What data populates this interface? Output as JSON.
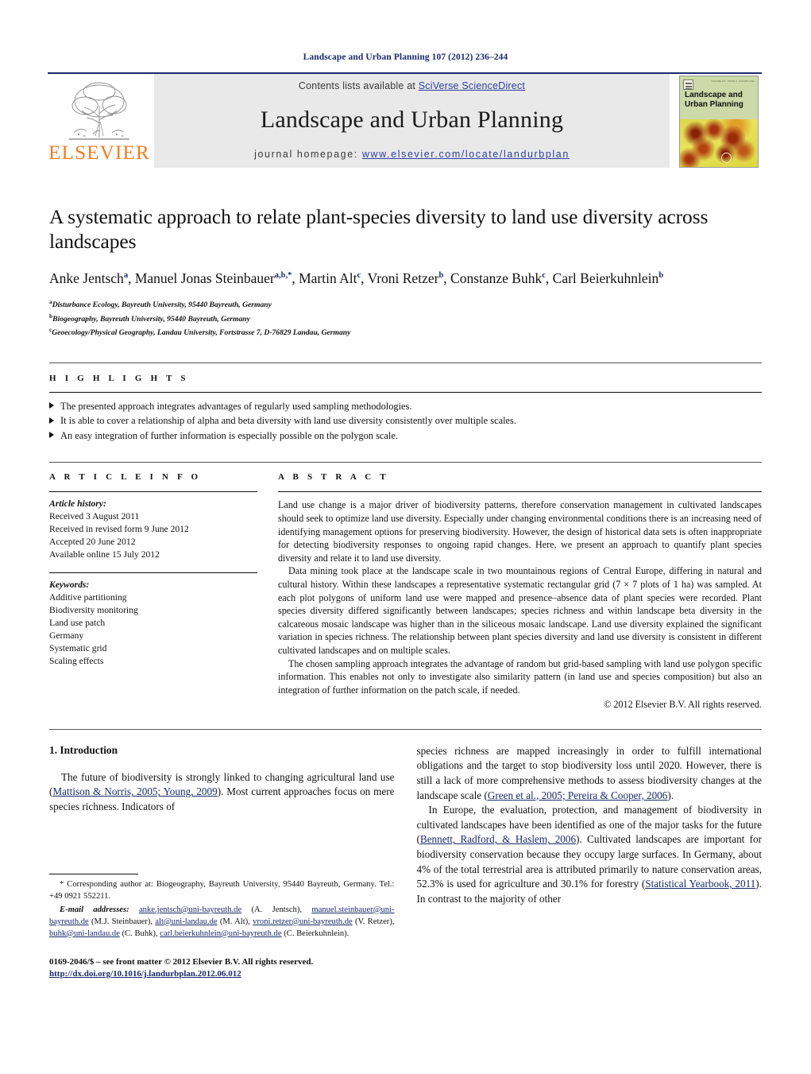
{
  "running_head": "Landscape and Urban Planning 107 (2012) 236–244",
  "masthead": {
    "publisher_wordmark": "ELSEVIER",
    "publisher_logo_icon": "elsevier-tree-icon",
    "contents_prefix": "Contents lists available at ",
    "contents_link": "SciVerse ScienceDirect",
    "journal_title": "Landscape and Urban Planning",
    "homepage_prefix": "journal homepage: ",
    "homepage_url": "www.elsevier.com/locate/landurbplan",
    "cover": {
      "journal_title_line1": "Landscape and",
      "journal_title_line2": "Urban Planning",
      "micro_text": "VOLUME 107 · ISSUE 3 · AUGUST 2012",
      "badge_icon": "elsevier-cover-badge-icon"
    }
  },
  "article": {
    "title": "A systematic approach to relate plant-species diversity to land use diversity across landscapes",
    "authors": [
      {
        "name": "Anke Jentsch",
        "sup": "a",
        "sep": ", "
      },
      {
        "name": "Manuel Jonas Steinbauer",
        "sup": "a,b,*",
        "sep": ", "
      },
      {
        "name": "Martin Alt",
        "sup": "c",
        "sep": ", "
      },
      {
        "name": "Vroni Retzer",
        "sup": "b",
        "sep": ", "
      },
      {
        "name": "Constanze Buhk",
        "sup": "c",
        "sep": ", "
      },
      {
        "name": "Carl Beierkuhnlein",
        "sup": "b",
        "sep": ""
      }
    ],
    "affiliations": [
      {
        "sup": "a",
        "text": "Disturbance Ecology, Bayreuth University, 95440 Bayreuth, Germany"
      },
      {
        "sup": "b",
        "text": "Biogeography, Bayreuth University, 95440 Bayreuth, Germany"
      },
      {
        "sup": "c",
        "text": "Geoecology/Physical Geography, Landau University, Fortstrasse 7, D-76829 Landau, Germany"
      }
    ]
  },
  "highlights": {
    "label": "H I G H L I G H T S",
    "items": [
      "The presented approach integrates advantages of regularly used sampling methodologies.",
      "It is able to cover a relationship of alpha and beta diversity with land use diversity consistently over multiple scales.",
      "An easy integration of further information is especially possible on the polygon scale."
    ]
  },
  "article_info": {
    "label": "A R T I C L E    I N F O",
    "history_head": "Article history:",
    "history": [
      "Received 3 August 2011",
      "Received in revised form 9 June 2012",
      "Accepted 20 June 2012",
      "Available online 15 July 2012"
    ],
    "keywords_head": "Keywords:",
    "keywords": [
      "Additive partitioning",
      "Biodiversity monitoring",
      "Land use patch",
      "Germany",
      "Systematic grid",
      "Scaling effects"
    ]
  },
  "abstract": {
    "label": "A B S T R A C T",
    "paragraphs": [
      "Land use change is a major driver of biodiversity patterns, therefore conservation management in cultivated landscapes should seek to optimize land use diversity. Especially under changing environmental conditions there is an increasing need of identifying management options for preserving biodiversity. However, the design of historical data sets is often inappropriate for detecting biodiversity responses to ongoing rapid changes. Here, we present an approach to quantify plant species diversity and relate it to land use diversity.",
      "Data mining took place at the landscape scale in two mountainous regions of Central Europe, differing in natural and cultural history. Within these landscapes a representative systematic rectangular grid (7 × 7 plots of 1 ha) was sampled. At each plot polygons of uniform land use were mapped and presence–absence data of plant species were recorded. Plant species diversity differed significantly between landscapes; species richness and within landscape beta diversity in the calcareous mosaic landscape was higher than in the siliceous mosaic landscape. Land use diversity explained the significant variation in species richness. The relationship between plant species diversity and land use diversity is consistent in different cultivated landscapes and on multiple scales.",
      "The chosen sampling approach integrates the advantage of random but grid-based sampling with land use polygon specific information. This enables not only to investigate also similarity pattern (in land use and species composition) but also an integration of further information on the patch scale, if needed."
    ],
    "copyright": "© 2012 Elsevier B.V. All rights reserved."
  },
  "body": {
    "section_heading": "1.  Introduction",
    "left_paragraph_pre": "The future of biodiversity is strongly linked to changing agricultural land use (",
    "left_citation_1": "Mattison & Norris, 2005; Young, 2009",
    "left_paragraph_post": "). Most current approaches focus on mere species richness. Indicators of",
    "right_p1_pre": "species richness are mapped increasingly in order to fulfill international obligations and the target to stop biodiversity loss until 2020. However, there is still a lack of more comprehensive methods to assess biodiversity changes at the landscape scale (",
    "right_p1_cite": "Green et al., 2005; Pereira & Cooper, 2006",
    "right_p1_post": ").",
    "right_p2_pre": "In Europe, the evaluation, protection, and management of biodiversity in cultivated landscapes have been identified as one of the major tasks for the future (",
    "right_p2_cite1": "Bennett, Radford, & Haslem, 2006",
    "right_p2_mid": "). Cultivated landscapes are important for biodiversity conservation because they occupy large surfaces. In Germany, about 4% of the total terrestrial area is attributed primarily to nature conservation areas, 52.3% is used for agriculture and 30.1% for forestry (",
    "right_p2_cite2": "Statistical Yearbook, 2011",
    "right_p2_post": "). In contrast to the majority of other"
  },
  "footnotes": {
    "corresponding_marker": "*",
    "corresponding": "Corresponding author at: Biogeography, Bayreuth University, 95440 Bayreuth, Germany. Tel.: +49 0921 552211.",
    "email_label": "E-mail addresses:",
    "emails": [
      {
        "address": "anke.jentsch@uni-bayreuth.de",
        "owner": "(A. Jentsch),"
      },
      {
        "address": "manuel.steinbauer@uni-bayreuth.de",
        "owner": "(M.J. Steinbauer),"
      },
      {
        "address": "alt@uni-landau.de",
        "owner": "(M. Alt),"
      },
      {
        "address": "vroni.retzer@uni-bayreuth.de",
        "owner": "(V. Retzer),"
      },
      {
        "address": "buhk@uni-landau.de",
        "owner": "(C. Buhk),"
      },
      {
        "address": "carl.beierkuhnlein@uni-bayreuth.de",
        "owner": "(C. Beierkuhnlein)."
      }
    ],
    "issn_line": "0169-2046/$ – see front matter © 2012 Elsevier B.V. All rights reserved.",
    "doi_line": "http://dx.doi.org/10.1016/j.landurbplan.2012.06.012"
  },
  "colors": {
    "accent_blue": "#1b2a6b",
    "link_blue": "#2b3f9e",
    "elsevier_orange": "#f47b20",
    "masthead_grey": "#e9e9e9"
  }
}
